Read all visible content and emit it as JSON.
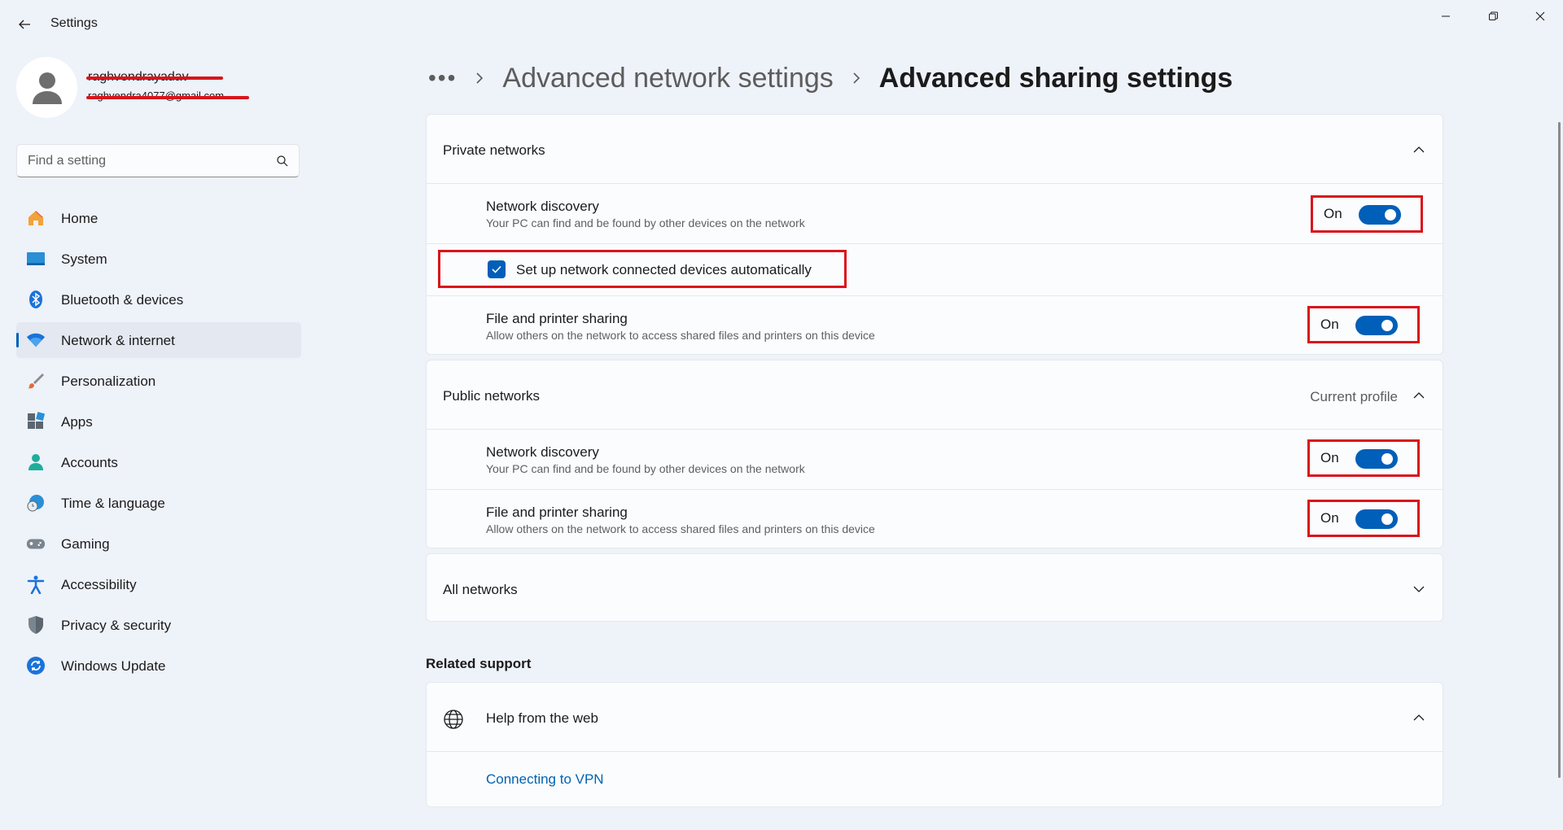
{
  "window": {
    "title": "Settings",
    "controls": {
      "minimize": "minimize-icon",
      "maximize": "restore-icon",
      "close": "close-icon"
    }
  },
  "profile": {
    "name": "raghvendrayadav",
    "email": "raghvendra4077@gmail.com"
  },
  "search": {
    "placeholder": "Find a setting"
  },
  "sidebar": {
    "items": [
      {
        "label": "Home",
        "icon": "home-icon"
      },
      {
        "label": "System",
        "icon": "system-icon"
      },
      {
        "label": "Bluetooth & devices",
        "icon": "bluetooth-icon"
      },
      {
        "label": "Network & internet",
        "icon": "wifi-icon",
        "active": true
      },
      {
        "label": "Personalization",
        "icon": "brush-icon"
      },
      {
        "label": "Apps",
        "icon": "apps-icon"
      },
      {
        "label": "Accounts",
        "icon": "accounts-icon"
      },
      {
        "label": "Time & language",
        "icon": "globe-clock-icon"
      },
      {
        "label": "Gaming",
        "icon": "gamepad-icon"
      },
      {
        "label": "Accessibility",
        "icon": "accessibility-icon"
      },
      {
        "label": "Privacy & security",
        "icon": "shield-icon"
      },
      {
        "label": "Windows Update",
        "icon": "update-icon"
      }
    ]
  },
  "breadcrumb": {
    "more": "•••",
    "parent": "Advanced network settings",
    "current": "Advanced sharing settings"
  },
  "private_networks": {
    "title": "Private networks",
    "network_discovery": {
      "title": "Network discovery",
      "desc": "Your PC can find and be found by other devices on the network",
      "state": "On"
    },
    "auto_setup": {
      "label": "Set up network connected devices automatically",
      "checked": true
    },
    "file_sharing": {
      "title": "File and printer sharing",
      "desc": "Allow others on the network to access shared files and printers on this device",
      "state": "On"
    }
  },
  "public_networks": {
    "title": "Public networks",
    "badge": "Current profile",
    "network_discovery": {
      "title": "Network discovery",
      "desc": "Your PC can find and be found by other devices on the network",
      "state": "On"
    },
    "file_sharing": {
      "title": "File and printer sharing",
      "desc": "Allow others on the network to access shared files and printers on this device",
      "state": "On"
    }
  },
  "all_networks": {
    "title": "All networks"
  },
  "related_support": {
    "heading": "Related support",
    "help_title": "Help from the web",
    "link": "Connecting to VPN"
  },
  "colors": {
    "accent": "#005fb8",
    "highlight": "#d9141b",
    "background": "#eef2f9",
    "card": "#fbfcfe"
  }
}
